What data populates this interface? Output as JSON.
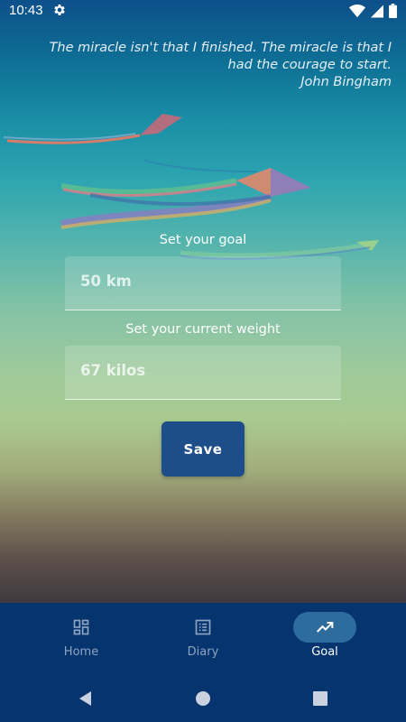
{
  "status_bar": {
    "time": "10:43",
    "icons": [
      "settings-gear-icon",
      "wifi-icon",
      "cell-signal-icon",
      "battery-icon"
    ]
  },
  "quote": {
    "text": "The miracle isn't that I finished. The miracle is that I had the courage to start.",
    "author": "John Bingham"
  },
  "form": {
    "goal_label": "Set your goal",
    "goal_value": "50 km",
    "weight_label": "Set your current weight",
    "weight_value": "67 kilos",
    "save_label": "Save"
  },
  "bottom_nav": {
    "items": [
      {
        "label": "Home",
        "icon": "dashboard-icon",
        "active": false
      },
      {
        "label": "Diary",
        "icon": "list-icon",
        "active": false
      },
      {
        "label": "Goal",
        "icon": "trending-up-icon",
        "active": true
      }
    ]
  },
  "system_nav": {
    "icons": [
      "back-icon",
      "home-icon",
      "recents-icon"
    ]
  },
  "colors": {
    "nav_background": "#06346f",
    "button": "#1e4e8a",
    "active_pill": "#2f6c9e"
  }
}
